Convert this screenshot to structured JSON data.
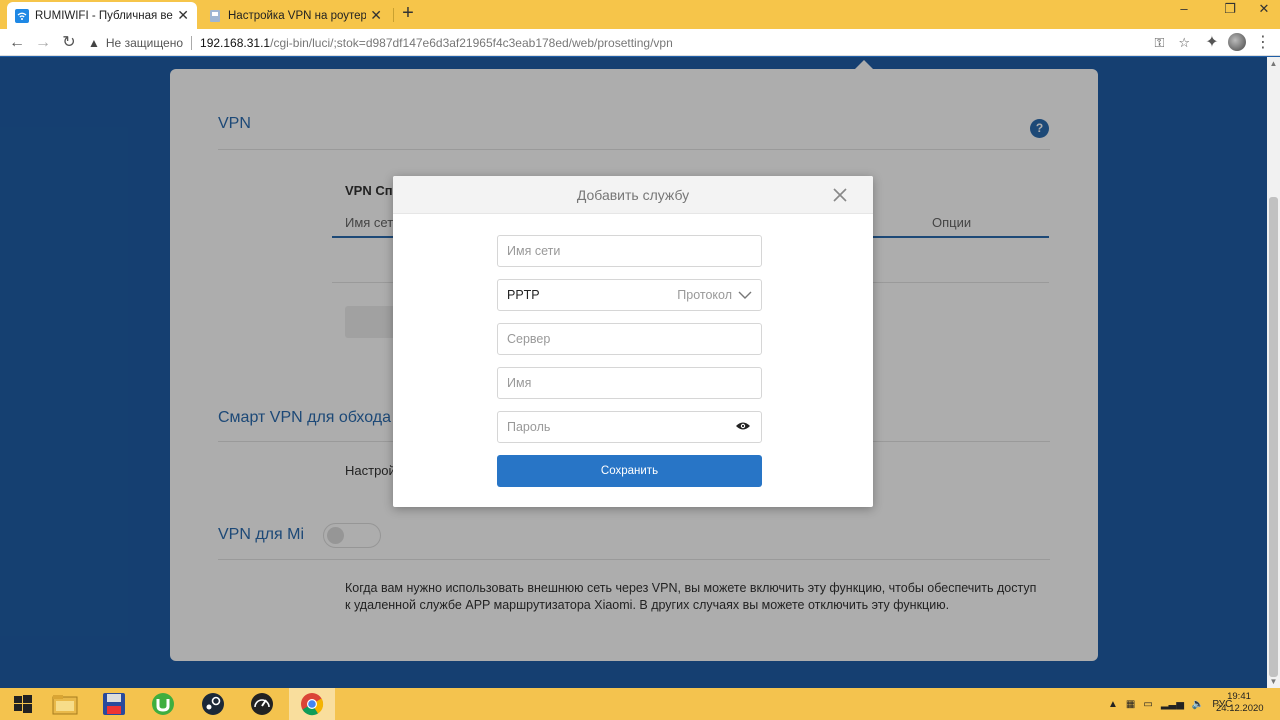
{
  "browser": {
    "tabs": [
      {
        "title": "RUMIWIFI - Публичная версия",
        "active": true
      },
      {
        "title": "Настройка VPN на роутере Xiaomi",
        "active": false
      }
    ],
    "new_tab": "+",
    "window": {
      "min": "–",
      "max": "❐",
      "close": "✕"
    },
    "security_label": "Не защищено",
    "url_host": "192.168.31.1",
    "url_path": "/cgi-bin/luci/;stok=d987df147e6d3af21965f4c3eab178ed/web/prosetting/vpn"
  },
  "page": {
    "vpn_title": "VPN",
    "help": "?",
    "vpn_list_label": "VPN Сп",
    "col_name": "Имя сети",
    "col_options": "Опции",
    "smart_vpn_title": "Смарт VPN для обхода б",
    "smart_vpn_text": "Настрой",
    "vpn_mi_title": "VPN для Mi",
    "vpn_mi_desc": "Когда вам нужно использовать внешнюю сеть через VPN, вы можете включить эту функцию, чтобы обеспечить доступ к удаленной службе APP маршрутизатора Xiaomi. В других случаях вы можете отключить эту функцию."
  },
  "modal": {
    "title": "Добавить службу",
    "network_name_placeholder": "Имя сети",
    "protocol_value": "PPTP",
    "protocol_label": "Протокол",
    "server_placeholder": "Сервер",
    "username_placeholder": "Имя",
    "password_placeholder": "Пароль",
    "save_label": "Сохранить"
  },
  "taskbar": {
    "apps": [
      "start-icon",
      "file-explorer-icon",
      "save-floppy-icon",
      "utorrent-icon",
      "steam-icon",
      "speedometer-icon",
      "chrome-icon"
    ],
    "tray_lang": "РУС",
    "time": "19:41",
    "date": "24.12.2020"
  },
  "colors": {
    "accent": "#2875c6",
    "tab_strip": "#f6c54a",
    "page_bg": "#1f5ea7",
    "taskbar": "#f4c34e"
  }
}
